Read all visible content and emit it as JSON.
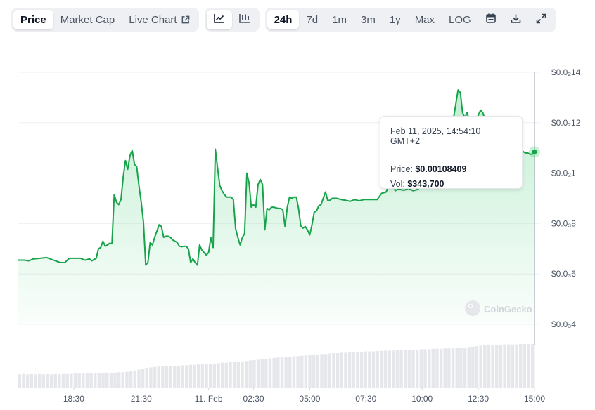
{
  "toolbar": {
    "view_tabs": [
      {
        "label": "Price",
        "active": true
      },
      {
        "label": "Market Cap",
        "active": false
      },
      {
        "label": "Live Chart",
        "active": false
      }
    ],
    "chart_type_icons": [
      "line-chart-icon",
      "candlestick-chart-icon"
    ],
    "ranges": [
      {
        "label": "24h",
        "active": true
      },
      {
        "label": "7d",
        "active": false
      },
      {
        "label": "1m",
        "active": false
      },
      {
        "label": "3m",
        "active": false
      },
      {
        "label": "1y",
        "active": false
      },
      {
        "label": "Max",
        "active": false
      },
      {
        "label": "LOG",
        "active": false
      }
    ],
    "action_icons": [
      "calendar-icon",
      "download-icon",
      "expand-icon"
    ]
  },
  "tooltip": {
    "date": "Feb 11, 2025, 14:54:10 GMT+2",
    "price_label": "Price:",
    "price_value": "$0.00108409",
    "vol_label": "Vol:",
    "vol_value": "$343,700"
  },
  "watermark": "CoinGecko",
  "colors": {
    "line": "#16a34a",
    "area": "#22c55e",
    "volume": "#e5e7eb",
    "grid": "#eef0f3"
  },
  "chart_data": {
    "type": "line",
    "y_axis_position": "right",
    "yticks": [
      {
        "value": 0.0014,
        "label": "$0.0₂14"
      },
      {
        "value": 0.0012,
        "label": "$0.0₂12"
      },
      {
        "value": 0.001,
        "label": "$0.0₂1"
      },
      {
        "value": 0.0008,
        "label": "$0.0₃8"
      },
      {
        "value": 0.0006,
        "label": "$0.0₃6"
      },
      {
        "value": 0.0004,
        "label": "$0.0₃4"
      }
    ],
    "ylim": [
      0.0004,
      0.0014
    ],
    "xlim_hours": [
      16.0,
      39.0
    ],
    "xticks": [
      {
        "hour": 18.5,
        "label": "18:30"
      },
      {
        "hour": 21.5,
        "label": "21:30"
      },
      {
        "hour": 24.5,
        "label": "11. Feb"
      },
      {
        "hour": 26.5,
        "label": "02:30"
      },
      {
        "hour": 29.0,
        "label": "05:00"
      },
      {
        "hour": 31.5,
        "label": "07:30"
      },
      {
        "hour": 34.0,
        "label": "10:00"
      },
      {
        "hour": 36.5,
        "label": "12:30"
      },
      {
        "hour": 39.0,
        "label": "15:00"
      }
    ],
    "series": [
      {
        "points": [
          [
            16.0,
            0.000655
          ],
          [
            16.3,
            0.000655
          ],
          [
            16.5,
            0.000652
          ],
          [
            16.7,
            0.00066
          ],
          [
            17.0,
            0.000662
          ],
          [
            17.3,
            0.000665
          ],
          [
            17.6,
            0.000655
          ],
          [
            17.9,
            0.000645
          ],
          [
            18.1,
            0.000645
          ],
          [
            18.3,
            0.000662
          ],
          [
            18.6,
            0.000662
          ],
          [
            18.8,
            0.000662
          ],
          [
            19.0,
            0.000655
          ],
          [
            19.2,
            0.00066
          ],
          [
            19.3,
            0.000652
          ],
          [
            19.5,
            0.000662
          ],
          [
            19.6,
            0.0007
          ],
          [
            19.7,
            0.000705
          ],
          [
            19.8,
            0.00073
          ],
          [
            19.9,
            0.00071
          ],
          [
            20.0,
            0.000715
          ],
          [
            20.1,
            0.000722
          ],
          [
            20.2,
            0.00072
          ],
          [
            20.3,
            0.000915
          ],
          [
            20.4,
            0.000885
          ],
          [
            20.5,
            0.000875
          ],
          [
            20.6,
            0.000895
          ],
          [
            20.7,
            0.000985
          ],
          [
            20.8,
            0.00105
          ],
          [
            20.9,
            0.001015
          ],
          [
            21.0,
            0.00107
          ],
          [
            21.1,
            0.00109
          ],
          [
            21.2,
            0.001035
          ],
          [
            21.3,
            0.001025
          ],
          [
            21.4,
            0.00095
          ],
          [
            21.5,
            0.000885
          ],
          [
            21.6,
            0.000805
          ],
          [
            21.7,
            0.000635
          ],
          [
            21.8,
            0.000645
          ],
          [
            21.9,
            0.000725
          ],
          [
            22.0,
            0.000715
          ],
          [
            22.1,
            0.000745
          ],
          [
            22.2,
            0.00077
          ],
          [
            22.3,
            0.000795
          ],
          [
            22.4,
            0.000788
          ],
          [
            22.5,
            0.000745
          ],
          [
            22.6,
            0.00075
          ],
          [
            22.7,
            0.00075
          ],
          [
            22.8,
            0.000745
          ],
          [
            22.9,
            0.000735
          ],
          [
            23.0,
            0.00073
          ],
          [
            23.1,
            0.000725
          ],
          [
            23.2,
            0.00071
          ],
          [
            23.3,
            0.000708
          ],
          [
            23.4,
            0.00071
          ],
          [
            23.5,
            0.00071
          ],
          [
            23.6,
            0.0007
          ],
          [
            23.7,
            0.000645
          ],
          [
            23.8,
            0.00066
          ],
          [
            23.9,
            0.000645
          ],
          [
            24.0,
            0.000635
          ],
          [
            24.1,
            0.000715
          ],
          [
            24.2,
            0.000695
          ],
          [
            24.3,
            0.000685
          ],
          [
            24.4,
            0.000675
          ],
          [
            24.5,
            0.000685
          ],
          [
            24.6,
            0.000745
          ],
          [
            24.7,
            0.000705
          ],
          [
            24.8,
            0.001095
          ],
          [
            24.9,
            0.00102
          ],
          [
            25.0,
            0.00095
          ],
          [
            25.1,
            0.00093
          ],
          [
            25.2,
            0.000915
          ],
          [
            25.3,
            0.000905
          ],
          [
            25.4,
            0.000905
          ],
          [
            25.5,
            0.000905
          ],
          [
            25.6,
            0.000895
          ],
          [
            25.7,
            0.00078
          ],
          [
            25.8,
            0.000745
          ],
          [
            25.9,
            0.000715
          ],
          [
            26.0,
            0.000745
          ],
          [
            26.1,
            0.00076
          ],
          [
            26.2,
            0.001
          ],
          [
            26.3,
            0.00096
          ],
          [
            26.4,
            0.000865
          ],
          [
            26.5,
            0.000875
          ],
          [
            26.6,
            0.000865
          ],
          [
            26.7,
            0.000955
          ],
          [
            26.8,
            0.000975
          ],
          [
            26.9,
            0.000955
          ],
          [
            27.0,
            0.000775
          ],
          [
            27.1,
            0.00086
          ],
          [
            27.2,
            0.000855
          ],
          [
            27.3,
            0.000865
          ],
          [
            27.4,
            0.000865
          ],
          [
            27.5,
            0.000862
          ],
          [
            27.6,
            0.00086
          ],
          [
            27.7,
            0.00086
          ],
          [
            27.8,
            0.000855
          ],
          [
            27.9,
            0.000788
          ],
          [
            28.0,
            0.000865
          ],
          [
            28.1,
            0.000905
          ],
          [
            28.2,
            0.0009
          ],
          [
            28.3,
            0.000905
          ],
          [
            28.4,
            0.000905
          ],
          [
            28.5,
            0.00086
          ],
          [
            28.6,
            0.00079
          ],
          [
            28.7,
            0.000782
          ],
          [
            28.8,
            0.000788
          ],
          [
            28.9,
            0.000775
          ],
          [
            29.0,
            0.000755
          ],
          [
            29.1,
            0.000795
          ],
          [
            29.2,
            0.000845
          ],
          [
            29.3,
            0.00085
          ],
          [
            29.4,
            0.00087
          ],
          [
            29.5,
            0.000875
          ],
          [
            29.6,
            0.0009
          ],
          [
            29.7,
            0.000925
          ],
          [
            29.8,
            0.000892
          ],
          [
            29.9,
            0.000892
          ],
          [
            30.0,
            0.0009
          ],
          [
            30.2,
            0.0009
          ],
          [
            30.4,
            0.000895
          ],
          [
            30.6,
            0.000892
          ],
          [
            30.8,
            0.000888
          ],
          [
            31.0,
            0.000895
          ],
          [
            31.2,
            0.00089
          ],
          [
            31.4,
            0.000895
          ],
          [
            31.6,
            0.000895
          ],
          [
            31.8,
            0.000895
          ],
          [
            32.0,
            0.000895
          ],
          [
            32.2,
            0.00092
          ],
          [
            32.4,
            0.000925
          ],
          [
            32.6,
            0.000975
          ],
          [
            32.7,
            0.000985
          ],
          [
            32.8,
            0.00093
          ],
          [
            32.9,
            0.000935
          ],
          [
            33.0,
            0.000935
          ],
          [
            33.2,
            0.000932
          ],
          [
            33.4,
            0.00094
          ],
          [
            33.6,
            0.00093
          ],
          [
            33.8,
            0.000935
          ],
          [
            34.0,
            0.000955
          ],
          [
            34.2,
            0.00098
          ],
          [
            34.4,
            0.000998
          ],
          [
            34.6,
            0.00104
          ],
          [
            34.8,
            0.00106
          ],
          [
            35.0,
            0.00108
          ],
          [
            35.2,
            0.00112
          ],
          [
            35.4,
            0.00122
          ],
          [
            35.6,
            0.00133
          ],
          [
            35.7,
            0.00132
          ],
          [
            35.8,
            0.00124
          ],
          [
            35.9,
            0.00122
          ],
          [
            36.0,
            0.00124
          ],
          [
            36.1,
            0.00121
          ],
          [
            36.2,
            0.00118
          ],
          [
            36.3,
            0.00119
          ],
          [
            36.4,
            0.00121
          ],
          [
            36.5,
            0.00123
          ],
          [
            36.6,
            0.00125
          ],
          [
            36.7,
            0.00124
          ],
          [
            36.8,
            0.00121
          ],
          [
            37.0,
            0.0012
          ],
          [
            37.2,
            0.00118
          ],
          [
            37.4,
            0.00117
          ],
          [
            37.6,
            0.00115
          ],
          [
            37.8,
            0.00113
          ],
          [
            38.0,
            0.00112
          ],
          [
            38.2,
            0.00111
          ],
          [
            38.4,
            0.00109
          ],
          [
            38.6,
            0.00108
          ],
          [
            38.7,
            0.00108
          ],
          [
            38.8,
            0.001075
          ],
          [
            38.9,
            0.001075
          ],
          [
            39.0,
            0.00108409
          ]
        ]
      }
    ],
    "volume": {
      "note_units": "relative",
      "values": [
        0.3,
        0.31,
        0.3,
        0.31,
        0.3,
        0.31,
        0.3,
        0.31,
        0.3,
        0.31,
        0.3,
        0.31,
        0.31,
        0.31,
        0.32,
        0.32,
        0.32,
        0.32,
        0.33,
        0.33,
        0.33,
        0.33,
        0.34,
        0.34,
        0.34,
        0.35,
        0.35,
        0.36,
        0.37,
        0.39,
        0.41,
        0.43,
        0.45,
        0.46,
        0.47,
        0.48,
        0.48,
        0.49,
        0.49,
        0.5,
        0.5,
        0.51,
        0.51,
        0.52,
        0.52,
        0.53,
        0.53,
        0.54,
        0.54,
        0.55,
        0.56,
        0.57,
        0.57,
        0.58,
        0.59,
        0.6,
        0.6,
        0.61,
        0.62,
        0.63,
        0.64,
        0.65,
        0.66,
        0.67,
        0.68,
        0.69,
        0.69,
        0.7,
        0.71,
        0.72,
        0.72,
        0.73,
        0.74,
        0.75,
        0.76,
        0.76,
        0.77,
        0.77,
        0.78,
        0.79,
        0.79,
        0.8,
        0.8,
        0.81,
        0.81,
        0.82,
        0.82,
        0.83,
        0.83,
        0.83,
        0.84,
        0.84,
        0.85,
        0.85,
        0.85,
        0.86,
        0.86,
        0.86,
        0.87,
        0.87,
        0.87,
        0.88,
        0.88,
        0.88,
        0.89,
        0.89,
        0.89,
        0.9,
        0.9,
        0.9,
        0.91,
        0.91,
        0.92,
        0.93,
        0.94,
        0.95,
        0.96,
        0.97,
        0.97,
        0.98,
        0.98,
        0.98,
        0.99,
        0.99,
        0.99,
        0.99,
        1.0,
        1.0,
        1.0,
        1.0
      ]
    }
  }
}
